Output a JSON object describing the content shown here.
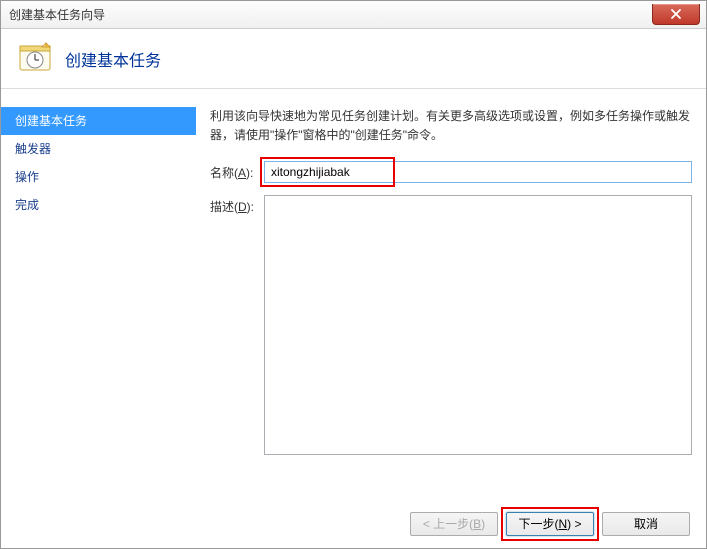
{
  "window": {
    "title": "创建基本任务向导"
  },
  "header": {
    "title": "创建基本任务"
  },
  "sidebar": {
    "items": [
      {
        "label": "创建基本任务",
        "active": true
      },
      {
        "label": "触发器",
        "active": false
      },
      {
        "label": "操作",
        "active": false
      },
      {
        "label": "完成",
        "active": false
      }
    ]
  },
  "content": {
    "description": "利用该向导快速地为常见任务创建计划。有关更多高级选项或设置，例如多任务操作或触发器，请使用\"操作\"窗格中的\"创建任务\"命令。",
    "name_label_prefix": "名称(",
    "name_label_key": "A",
    "name_label_suffix": "):",
    "name_value": "xitongzhijiabak",
    "desc_label_prefix": "描述(",
    "desc_label_key": "D",
    "desc_label_suffix": "):",
    "desc_value": ""
  },
  "footer": {
    "back_prefix": "< 上一步(",
    "back_key": "B",
    "back_suffix": ")",
    "next_prefix": "下一步(",
    "next_key": "N",
    "next_suffix": ") >",
    "cancel": "取消"
  }
}
